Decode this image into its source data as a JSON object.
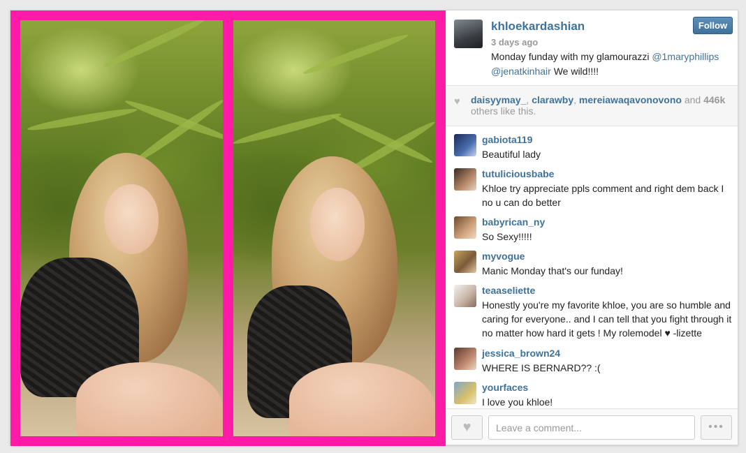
{
  "post": {
    "username": "khloekardashian",
    "timestamp": "3 days ago",
    "follow_label": "Follow",
    "caption_text": "Monday funday with my glamourazzi ",
    "mention_1": "@1maryphillips",
    "mention_2": "@jenatkinhair",
    "caption_end": " We wild!!!!"
  },
  "likes": {
    "icon": "heart-icon",
    "user_1": "daisyymay_",
    "sep_1": ", ",
    "user_2": "clarawby",
    "sep_2": ", ",
    "user_3": "mereiawaqavonovono",
    "and_text": " and ",
    "count": "446k",
    "suffix": " others like this."
  },
  "comments": [
    {
      "user": "gabiota119",
      "text": "Beautiful lady"
    },
    {
      "user": "tutuliciousbabe",
      "text": "Khloe try appreciate ppls comment and right dem back I no u can do better"
    },
    {
      "user": "babyrican_ny",
      "text": "So Sexy!!!!!"
    },
    {
      "user": "myvogue",
      "text": "Manic Monday that's our funday!"
    },
    {
      "user": "teaaseliette",
      "text": "Honestly you're my favorite khloe, you are so humble and caring for everyone.. and I can tell that you fight through it no matter how hard it gets ! My rolemodel ♥ -lizette"
    },
    {
      "user": "jessica_brown24",
      "text": "WHERE IS BERNARD?? :("
    },
    {
      "user": "yourfaces",
      "text": "I love you khloe!"
    }
  ],
  "footer": {
    "comment_placeholder": "Leave a comment...",
    "like_icon": "heart-icon",
    "more_label": "•••"
  },
  "colors": {
    "frame_pink": "#ff1aa8",
    "link_blue": "#3f729b",
    "muted_gray": "#999999"
  }
}
